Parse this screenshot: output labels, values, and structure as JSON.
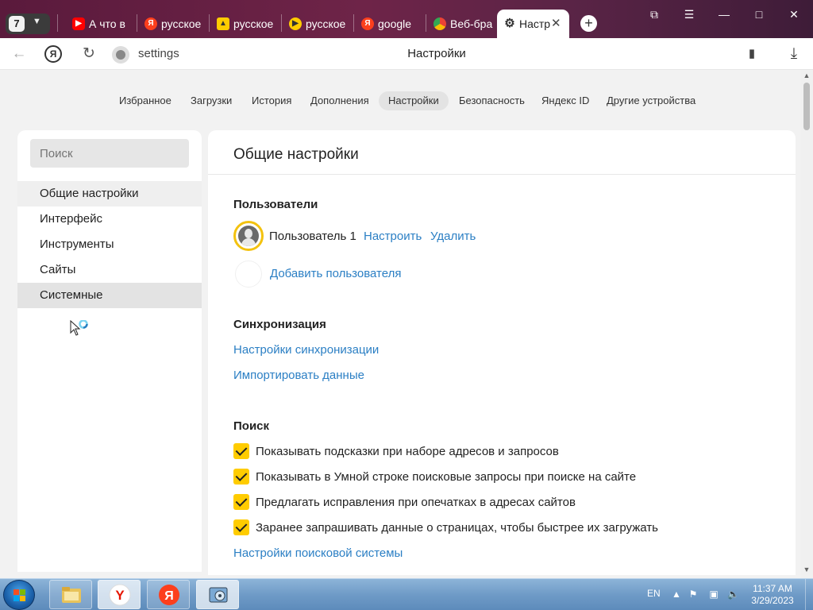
{
  "browser": {
    "tab_count": "7",
    "tabs": [
      {
        "title": "А что в",
        "icon": "youtube-icon",
        "color": "#ff0000"
      },
      {
        "title": "русское",
        "icon": "yandex-icon",
        "color": "#fc3f1d"
      },
      {
        "title": "русское",
        "icon": "yandex-images-icon",
        "color": "#ffcc00"
      },
      {
        "title": "русское",
        "icon": "yandex-video-icon",
        "color": "#ffcc00"
      },
      {
        "title": "google",
        "icon": "yandex-icon",
        "color": "#fc3f1d"
      },
      {
        "title": "Веб-бра",
        "icon": "chrome-icon",
        "color": "#4285f4"
      },
      {
        "title": "Настр",
        "icon": "gear-icon",
        "color": "#333333"
      }
    ],
    "address": "settings",
    "page_title": "Настройки"
  },
  "topnav": {
    "items": [
      "Избранное",
      "Загрузки",
      "История",
      "Дополнения",
      "Настройки",
      "Безопасность",
      "Яндекс ID",
      "Другие устройства"
    ],
    "active": "Настройки"
  },
  "sidebar": {
    "search_placeholder": "Поиск",
    "items": [
      "Общие настройки",
      "Интерфейс",
      "Инструменты",
      "Сайты",
      "Системные"
    ]
  },
  "main": {
    "title": "Общие настройки",
    "users": {
      "heading": "Пользователи",
      "user_name": "Пользователь 1",
      "configure": "Настроить",
      "delete": "Удалить",
      "add_user": "Добавить пользователя"
    },
    "sync": {
      "heading": "Синхронизация",
      "sync_settings": "Настройки синхронизации",
      "import_data": "Импортировать данные"
    },
    "search": {
      "heading": "Поиск",
      "options": [
        "Показывать подсказки при наборе адресов и запросов",
        "Показывать в Умной строке поисковые запросы при поиске на сайте",
        "Предлагать исправления при опечатках в адресах сайтов",
        "Заранее запрашивать данные о страницах, чтобы быстрее их загружать"
      ],
      "engine_settings": "Настройки поисковой системы"
    }
  },
  "taskbar": {
    "language": "EN",
    "time": "11:37 AM",
    "date": "3/29/2023"
  },
  "colors": {
    "accent_yellow": "#ffcc00",
    "link_blue": "#2b7fc4",
    "tabstrip": "#6e2448"
  }
}
